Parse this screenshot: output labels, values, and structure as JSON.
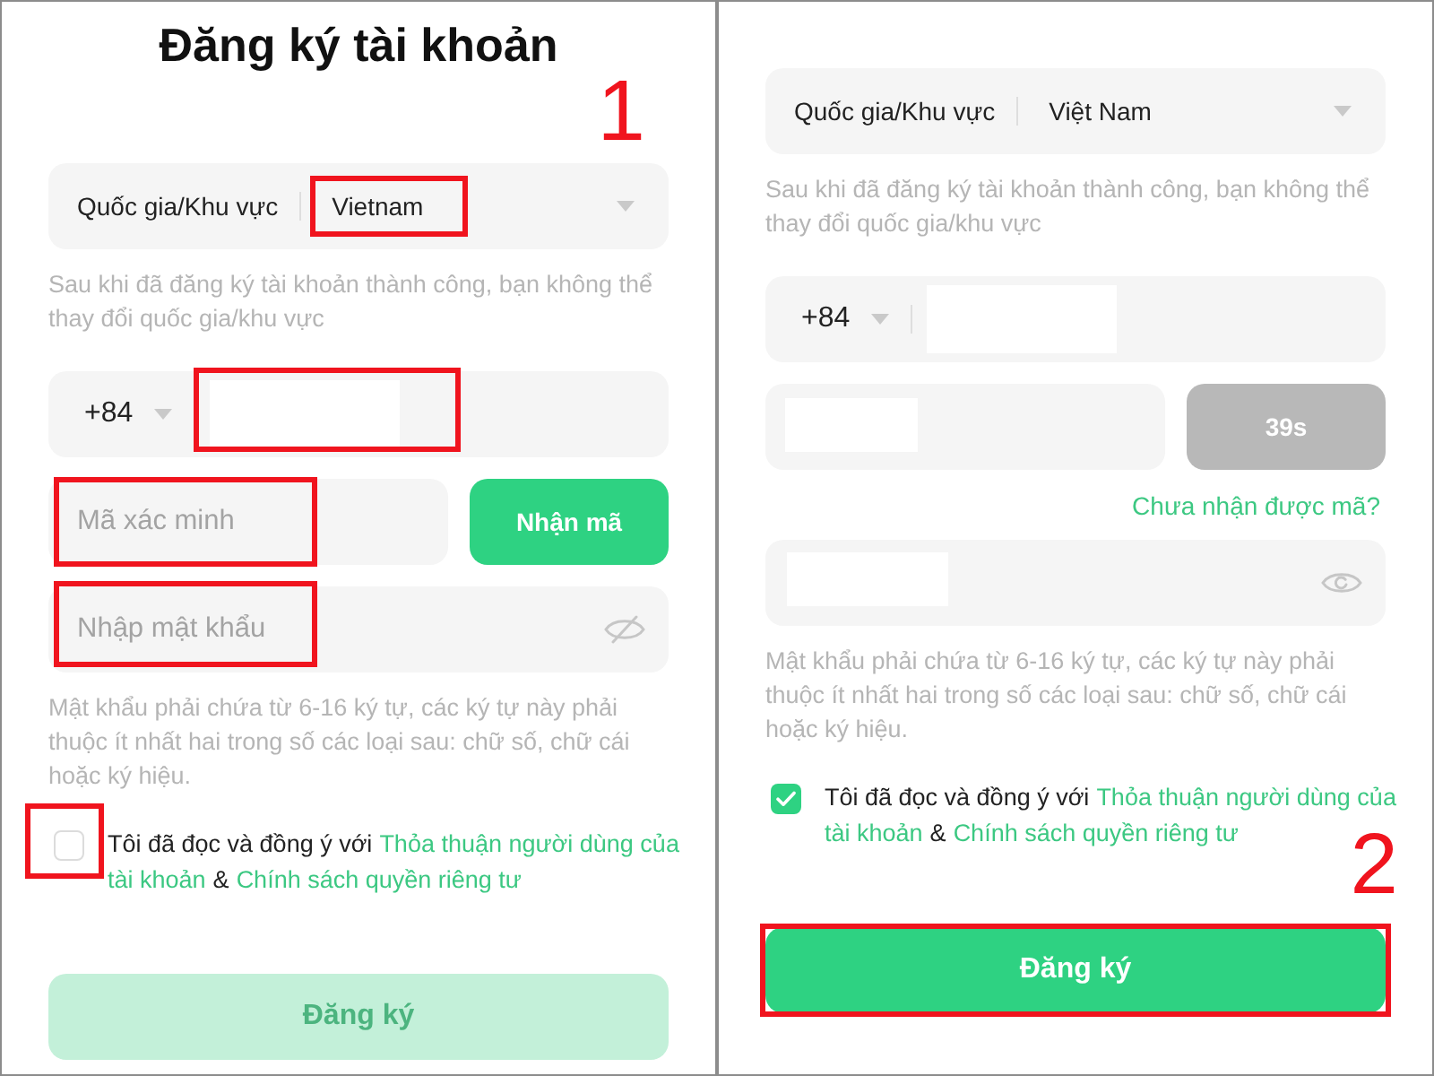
{
  "panels": [
    {
      "items": [
        {
          "kind": "title",
          "text": "Đăng ký tài khoản"
        },
        {
          "kind": "step",
          "text": "1"
        },
        {
          "kind": "country",
          "label": "Quốc gia/Khu vực",
          "value": "Vietnam",
          "highlighted": true
        },
        {
          "kind": "note",
          "text": "Sau khi đã đăng ký tài khoản thành công, bạn không thể thay đổi quốc gia/khu vực"
        },
        {
          "kind": "phone",
          "code": "+84",
          "redacted": true,
          "highlighted": true
        },
        {
          "kind": "code",
          "placeholder": "Mã xác minh",
          "redacted": false,
          "highlighted": true,
          "button": {
            "label": "Nhận mã",
            "disabled": false
          }
        },
        {
          "kind": "password",
          "placeholder": "Nhập mật khẩu",
          "redacted": false,
          "revealed": false,
          "highlighted": true
        },
        {
          "kind": "note",
          "text": "Mật khẩu phải chứa từ 6-16 ký tự, các ký tự này phải thuộc ít nhất hai trong số các loại sau: chữ số, chữ cái hoặc ký hiệu."
        },
        {
          "kind": "agreement",
          "checked": false,
          "highlighted": true,
          "parts": [
            {
              "kind": "text",
              "text": "Tôi đã đọc và đồng ý với"
            },
            {
              "kind": "link",
              "text": "Thỏa thuận người dùng của"
            },
            {
              "kind": "link",
              "text": "tài khoản"
            },
            {
              "kind": "text",
              "text": "&"
            },
            {
              "kind": "link",
              "text": "Chính sách quyền riêng tư"
            }
          ]
        },
        {
          "kind": "submit",
          "label": "Đăng ký",
          "disabled": true,
          "highlighted": false
        }
      ]
    },
    {
      "items": [
        {
          "kind": "country",
          "label": "Quốc gia/Khu vực",
          "value": "Việt Nam",
          "highlighted": false
        },
        {
          "kind": "note",
          "text": "Sau khi đã đăng ký tài khoản thành công, bạn không thể thay đổi quốc gia/khu vực"
        },
        {
          "kind": "phone",
          "code": "+84",
          "redacted": true,
          "highlighted": false
        },
        {
          "kind": "code",
          "redacted": true,
          "highlighted": false,
          "button": {
            "label": "39s",
            "disabled": true
          }
        },
        {
          "kind": "link",
          "text": "Chưa nhận được mã?"
        },
        {
          "kind": "password",
          "redacted": true,
          "revealed": true,
          "highlighted": false
        },
        {
          "kind": "note",
          "text": "Mật khẩu phải chứa từ 6-16 ký tự, các ký tự này phải thuộc ít nhất hai trong số các loại sau: chữ số, chữ cái hoặc ký hiệu."
        },
        {
          "kind": "agreement",
          "checked": true,
          "highlighted": false,
          "parts": [
            {
              "kind": "text",
              "text": "Tôi đã đọc và đồng ý với"
            },
            {
              "kind": "link",
              "text": "Thỏa thuận người dùng của"
            },
            {
              "kind": "link",
              "text": "tài khoản"
            },
            {
              "kind": "text",
              "text": "&"
            },
            {
              "kind": "link",
              "text": "Chính sách quyền riêng tư"
            }
          ]
        },
        {
          "kind": "step",
          "text": "2"
        },
        {
          "kind": "submit",
          "label": "Đăng ký",
          "disabled": false,
          "highlighted": true
        }
      ]
    }
  ]
}
